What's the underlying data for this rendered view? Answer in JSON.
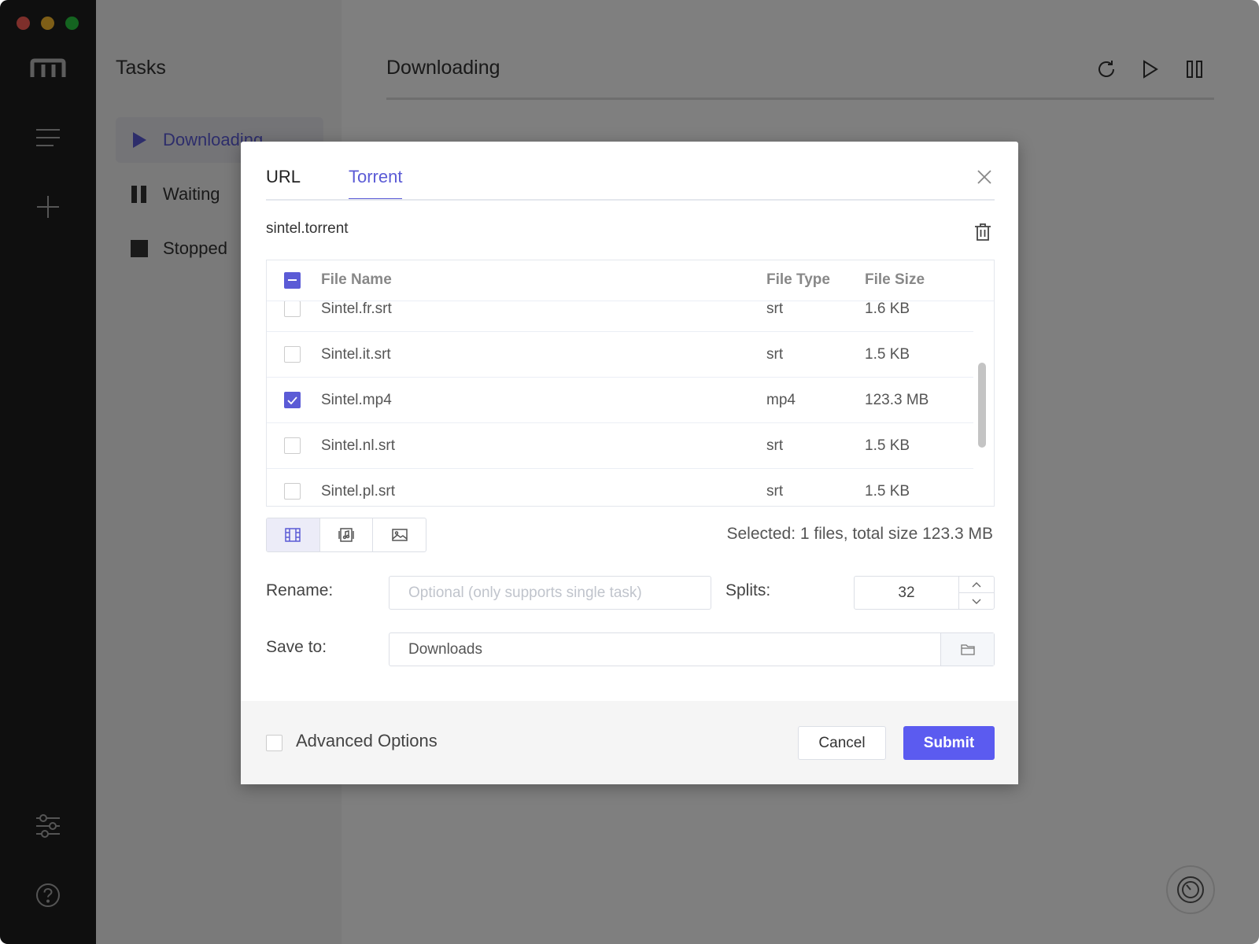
{
  "sidebar": {
    "icons": [
      "logo-icon",
      "menu-icon",
      "add-icon",
      "settings-icon",
      "help-icon"
    ]
  },
  "tasks": {
    "title": "Tasks",
    "items": [
      {
        "label": "Downloading",
        "icon": "play-icon",
        "active": true
      },
      {
        "label": "Waiting",
        "icon": "pause-icon",
        "active": false
      },
      {
        "label": "Stopped",
        "icon": "stop-icon",
        "active": false
      }
    ]
  },
  "main": {
    "title": "Downloading",
    "toolbar": [
      "refresh-icon",
      "resume-all-icon",
      "pause-all-icon"
    ]
  },
  "dialog": {
    "tabs": [
      {
        "label": "URL",
        "active": false
      },
      {
        "label": "Torrent",
        "active": true
      }
    ],
    "torrent_file": "sintel.torrent",
    "table": {
      "headers": {
        "name": "File Name",
        "type": "File Type",
        "size": "File Size"
      },
      "rows": [
        {
          "name": "Sintel.fr.srt",
          "type": "srt",
          "size": "1.6 KB",
          "checked": false
        },
        {
          "name": "Sintel.it.srt",
          "type": "srt",
          "size": "1.5 KB",
          "checked": false
        },
        {
          "name": "Sintel.mp4",
          "type": "mp4",
          "size": "123.3 MB",
          "checked": true
        },
        {
          "name": "Sintel.nl.srt",
          "type": "srt",
          "size": "1.5 KB",
          "checked": false
        },
        {
          "name": "Sintel.pl.srt",
          "type": "srt",
          "size": "1.5 KB",
          "checked": false
        }
      ]
    },
    "filter_icons": [
      "video-filter-icon",
      "audio-filter-icon",
      "image-filter-icon"
    ],
    "summary": "Selected: 1 files, total size 123.3 MB",
    "rename": {
      "label": "Rename:",
      "placeholder": "Optional (only supports single task)"
    },
    "splits": {
      "label": "Splits:",
      "value": "32"
    },
    "save_to": {
      "label": "Save to:",
      "value": "Downloads"
    },
    "advanced_label": "Advanced Options",
    "cancel_label": "Cancel",
    "submit_label": "Submit"
  },
  "colors": {
    "accent": "#5b5bf0",
    "rail": "#1f1f1f"
  }
}
